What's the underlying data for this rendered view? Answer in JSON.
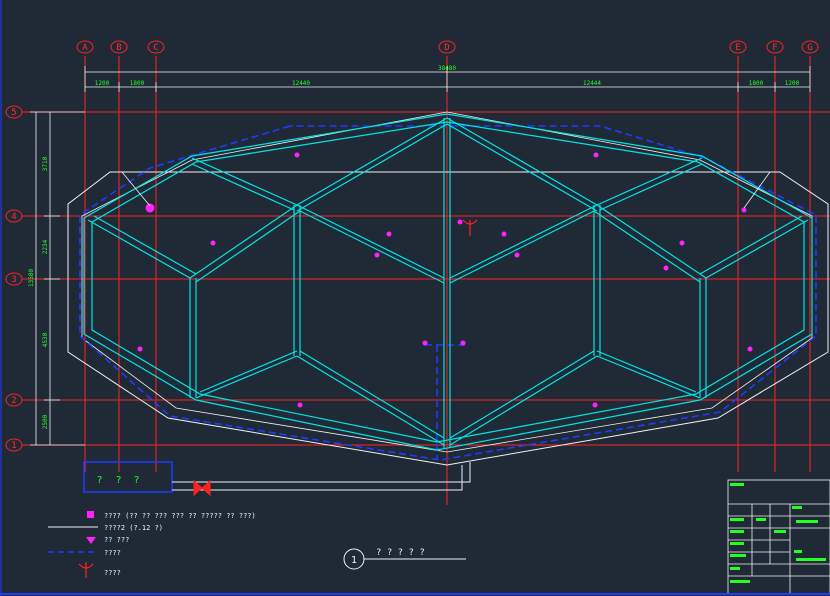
{
  "grid_columns": [
    "A",
    "B",
    "C",
    "D",
    "E",
    "F",
    "G"
  ],
  "grid_rows": [
    "5",
    "4",
    "3",
    "2",
    "1"
  ],
  "dimensions": {
    "top_overall": "38480",
    "top_segments": [
      "1200",
      "1800",
      "12440",
      "12444",
      "1800",
      "1200"
    ],
    "left_overall": "13580",
    "left_segments": [
      "3710",
      "2234",
      "4530",
      "2500"
    ]
  },
  "legend": [
    {
      "symbol": "magenta-square",
      "text": "???? (?? ?? ??? ??? ?? ????? ?? ???)"
    },
    {
      "symbol": "white-line",
      "text": "????2 (?.12 ?)"
    },
    {
      "symbol": "magenta-drop",
      "text": "?? ???"
    },
    {
      "symbol": "blue-dash-line",
      "text": "????"
    },
    {
      "symbol": "red-nozzle",
      "text": "????"
    }
  ],
  "section_callout": {
    "number": "1",
    "title": "? ? ? ? ?"
  },
  "colors": {
    "background": "#202a36",
    "grid": "#ff2020",
    "structure": "#00e5e5",
    "boundary": "#f2f2f2",
    "pipe": "#1e3cff",
    "dimension": "#22ff22",
    "device": "#ff22ff"
  }
}
